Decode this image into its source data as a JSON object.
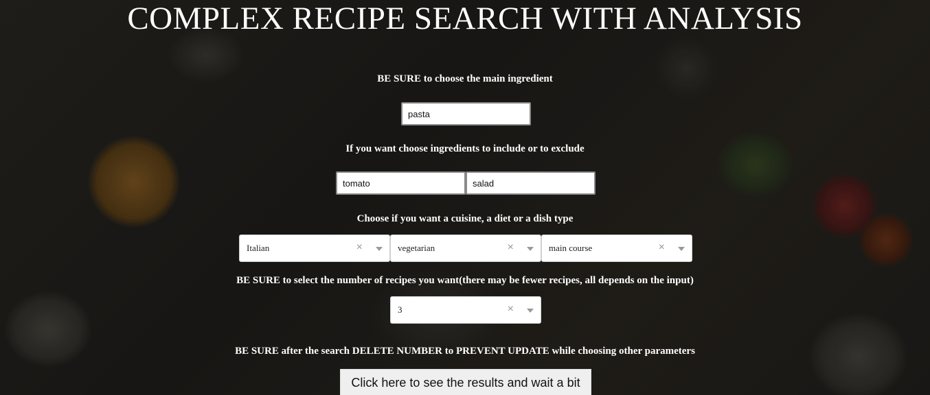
{
  "title": "COMPLEX RECIPE SEARCH WITH ANALYSIS",
  "main_ingredient": {
    "label": "BE SURE to choose the main ingredient",
    "value": "pasta"
  },
  "ingredients": {
    "label": "If you want choose ingredients to include or to exclude",
    "include_value": "tomato",
    "exclude_value": "salad"
  },
  "filters": {
    "label": "Choose if you want a cuisine, a diet or a dish type",
    "cuisine": "Italian",
    "diet": "vegetarian",
    "dish_type": "main course",
    "clear_glyph": "×"
  },
  "number": {
    "label": "BE SURE to select the number of recipes you want(there may be fewer recipes, all depends on the input)",
    "value": "3"
  },
  "warning": "BE SURE after the search DELETE NUMBER to PREVENT UPDATE while choosing other parameters",
  "submit_label": "Click here to see the results and wait a bit"
}
